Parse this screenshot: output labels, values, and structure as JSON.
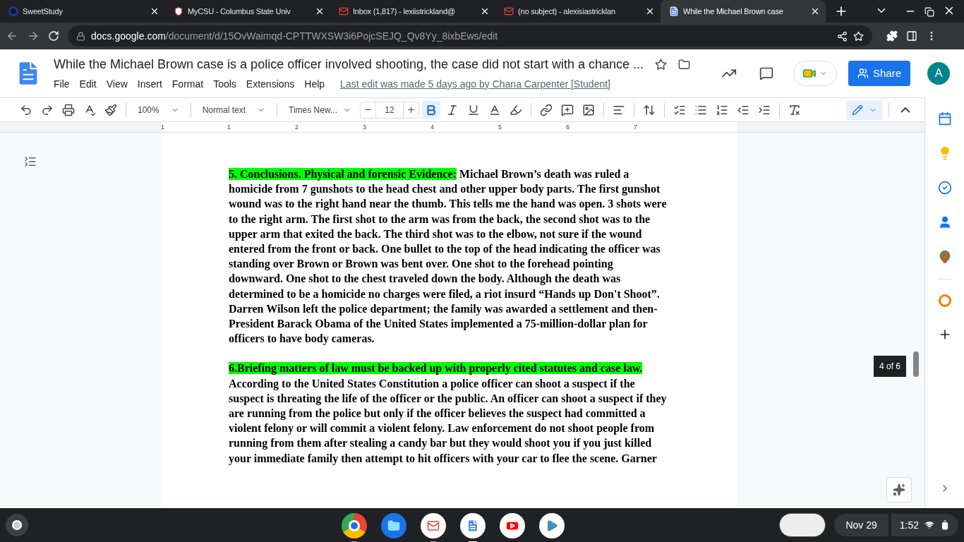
{
  "browser": {
    "tabs": [
      {
        "title": "SweetStudy",
        "selected": false
      },
      {
        "title": "MyCSU - Columbus State Univ",
        "selected": false
      },
      {
        "title": "Inbox (1,817) - lexiistrickland@",
        "selected": false
      },
      {
        "title": "(no subject) - alexisiastricklan",
        "selected": false
      },
      {
        "title": "While the Michael Brown case",
        "selected": true
      }
    ],
    "url_host": "docs.google.com",
    "url_path": "/document/d/15OvWaimqd-CPTTWXSW3i6PojcSEJQ_Qv8Yy_8ixbEws/edit"
  },
  "doc": {
    "title": "While the Michael Brown case is a police officer involved shooting, the case did not start with a chance ...",
    "menu": [
      "File",
      "Edit",
      "View",
      "Insert",
      "Format",
      "Tools",
      "Extensions",
      "Help"
    ],
    "last_edit": "Last edit was made 5 days ago by Chana Carpenter [Student]",
    "share": "Share",
    "avatar": "A"
  },
  "toolbar": {
    "zoom": "100%",
    "style": "Normal text",
    "font": "Times New...",
    "size": "12",
    "bold": {
      "selected": true
    },
    "italic": {
      "selected": false
    },
    "underline": {
      "selected": false
    },
    "edit_mode": {
      "selected": true
    }
  },
  "ruler": [
    "1",
    "1",
    "2",
    "3",
    "4",
    "5",
    "6",
    "7"
  ],
  "paragraphs": [
    {
      "heading": "5. Conclusions. Physical and forensic Evidence:",
      "text": " Michael Brown’s death was ruled a homicide from 7 gunshots to the head chest and other upper body parts. The first gunshot wound was to the right hand near the thumb. This tells me the hand was open. 3 shots were to the right arm. The first shot to the arm was from the back, the second shot was to the upper arm that exited the back. The third shot was to the elbow, not sure if the wound entered from the front or back. One bullet to the top of the head indicating the officer was standing over Brown or Brown was bent over. One shot to the forehead pointing downward. One shot to the chest traveled down the body. Although the death was determined to be a homicide no charges were filed, a riot insurd “Hands up Don't Shoot”. Darren Wilson left the police department; the family was awarded a settlement and then-President Barack Obama of the United States implemented a 75-million-dollar plan for officers to have body cameras."
    },
    {
      "heading": "6.Briefing matters of law must be backed up with properly cited statutes and case law.",
      "text": " According to the United States Constitution a police officer can shoot a suspect if the suspect is threating the life of the officer or the public. An officer can shoot a suspect if they are running from the police but only if the officer believes the suspect had committed a violent felony or will commit a violent felony. Law enforcement do not shoot people from running from them after stealing a candy bar but they would shoot you if you just killed your immediate family then attempt to hit officers with your car to flee the scene. Garner"
    }
  ],
  "page_tooltip": "4 of 6",
  "shelf": {
    "apps": [
      {
        "running": true,
        "selected": false
      },
      {
        "running": false,
        "selected": false
      },
      {
        "running": true,
        "selected": false
      },
      {
        "running": true,
        "selected": true
      },
      {
        "running": false,
        "selected": false
      },
      {
        "running": false,
        "selected": false
      }
    ],
    "date": "Nov 29",
    "time": "1:52"
  }
}
